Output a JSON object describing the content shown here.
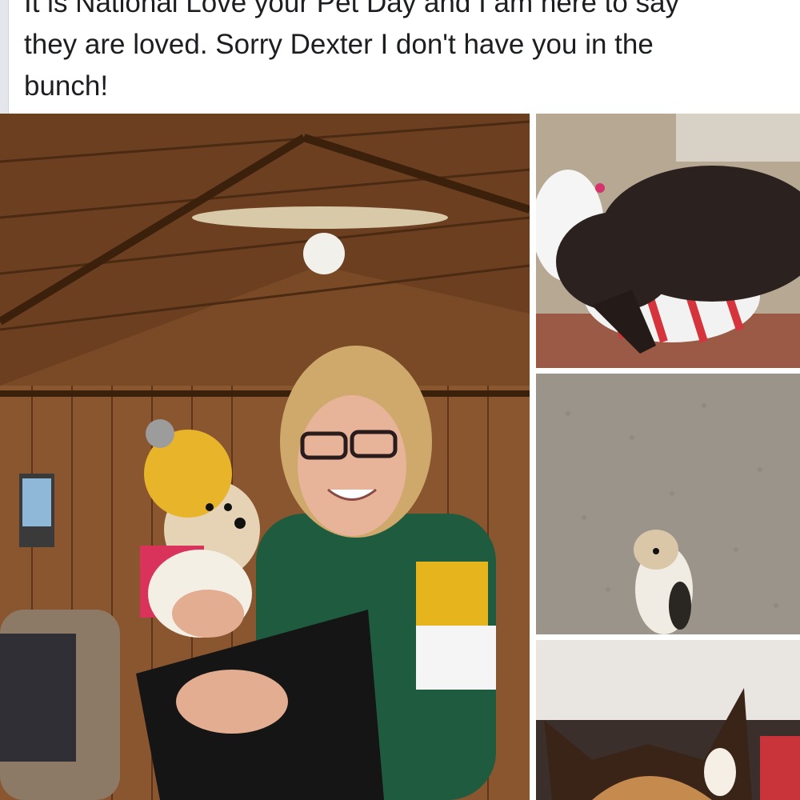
{
  "post": {
    "text_lines": [
      "It is National Love your Pet Day and I am here to say",
      "they are loved. Sorry Dexter I don't have you in the",
      "bunch!"
    ]
  },
  "photos": [
    {
      "subject": "woman-holding-dog-in-yellow-hat"
    },
    {
      "subject": "black-dog-sleeping-on-pillow"
    },
    {
      "subject": "small-dog-lying-on-carpet"
    },
    {
      "subject": "shepherd-dog-in-car"
    }
  ],
  "colors": {
    "text": "#1c1e21",
    "background": "#ffffff"
  }
}
